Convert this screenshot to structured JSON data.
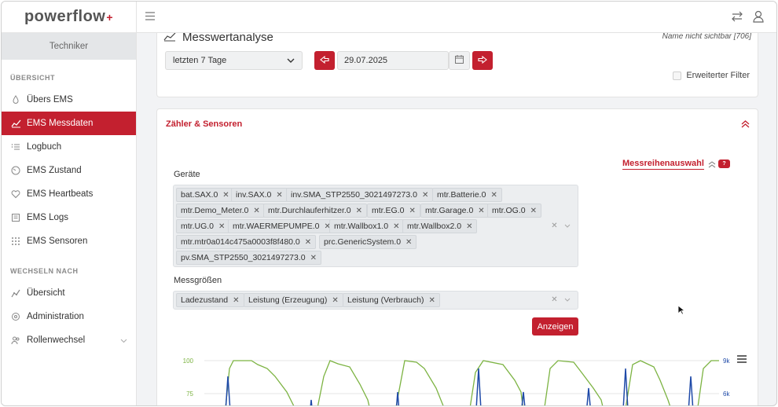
{
  "app": {
    "logo_text": "powerflow",
    "logo_plus": "+"
  },
  "sidebar": {
    "role": "Techniker",
    "section1": "ÜBERSICHT",
    "items": [
      {
        "label": "Übers EMS",
        "icon": "drop-icon"
      },
      {
        "label": "EMS Messdaten",
        "icon": "chart-line-icon",
        "active": true
      },
      {
        "label": "Logbuch",
        "icon": "list-icon"
      },
      {
        "label": "EMS Zustand",
        "icon": "gauge-icon"
      },
      {
        "label": "EMS Heartbeats",
        "icon": "heart-icon"
      },
      {
        "label": "EMS Logs",
        "icon": "document-icon"
      },
      {
        "label": "EMS Sensoren",
        "icon": "sensor-icon"
      }
    ],
    "section2": "WECHSELN NACH",
    "items2": [
      {
        "label": "Übersicht",
        "icon": "trend-icon"
      },
      {
        "label": "Administration",
        "icon": "gear-icon"
      },
      {
        "label": "Rollenwechsel",
        "icon": "users-icon"
      }
    ]
  },
  "topbar": {
    "menu_icon": "hamburger-icon",
    "swap_icon": "swap-icon",
    "user_icon": "user-icon"
  },
  "analysis": {
    "title": "Messwertanalyse",
    "hint": "Name nicht sichtbar [706]",
    "range_select": "letzten 7 Tage",
    "date": "29.07.2025",
    "filter_label": "Erweiterter Filter"
  },
  "sensors": {
    "title": "Zähler & Sensoren",
    "messreihen_link": "Messreihenauswahl",
    "help_badge": "?",
    "devices_label": "Geräte",
    "devices": [
      "bat.SAX.0",
      "inv.SAX.0",
      "inv.SMA_STP2550_3021497273.0",
      "mtr.Batterie.0",
      "mtr.Demo_Meter.0",
      "mtr.Durchlauferhitzer.0",
      "mtr.EG.0",
      "mtr.Garage.0",
      "mtr.OG.0",
      "mtr.UG.0",
      "mtr.WAERMEPUMPE.0",
      "mtr.Wallbox1.0",
      "mtr.Wallbox2.0",
      "mtr.mtr0a014c475a0003f8f480.0",
      "prc.GenericSystem.0",
      "pv.SMA_STP2550_3021497273.0"
    ],
    "quantities_label": "Messgrößen",
    "quantities": [
      "Ladezustand",
      "Leistung (Erzeugung)",
      "Leistung (Verbrauch)"
    ],
    "show_button": "Anzeigen"
  },
  "chart_data": {
    "type": "line",
    "y_left_ticks": [
      "100",
      "75"
    ],
    "y_right_ticks": [
      "9k",
      "6k"
    ],
    "series": [],
    "colors": {
      "green": "#7cb342",
      "blue": "#1f4aa8"
    }
  }
}
